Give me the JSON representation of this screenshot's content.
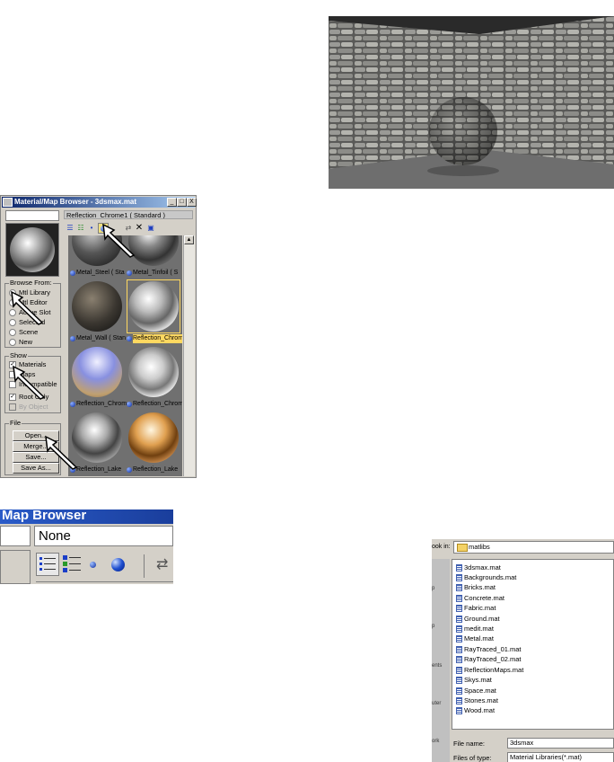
{
  "browser": {
    "title": "Material/Map Browser - 3dsmax.mat",
    "material_name": "Reflection_Chrome1  ( Standard )",
    "win_buttons": [
      "_",
      "□",
      "X"
    ],
    "toolbar_icons": [
      "view-list-icon",
      "view-list-icons-icon",
      "view-small-icon",
      "view-large-icon",
      "update-scene-icon",
      "delete-icon",
      "clear-library-icon"
    ],
    "browse_from": {
      "label": "Browse From:",
      "options": [
        "Mtl Library",
        "Mtl Editor",
        "Active Slot",
        "Selected",
        "Scene",
        "New"
      ],
      "selected": "Mtl Library"
    },
    "show": {
      "label": "Show",
      "options": [
        {
          "label": "Materials",
          "checked": true,
          "enabled": true
        },
        {
          "label": "Maps",
          "checked": false,
          "enabled": true
        },
        {
          "label": "Incompatible",
          "checked": false,
          "enabled": true
        },
        {
          "label": "Root Only",
          "checked": true,
          "enabled": true
        },
        {
          "label": "By Object",
          "checked": false,
          "enabled": false
        }
      ]
    },
    "file": {
      "label": "File",
      "buttons": [
        "Open...",
        "Merge...",
        "Save...",
        "Save As..."
      ]
    },
    "materials": [
      {
        "label": "Metal_Steel  ( Sta",
        "selected": false
      },
      {
        "label": "Metal_Tinfoil  ( S",
        "selected": false
      },
      {
        "label": "Metal_Wall  ( Stan",
        "selected": false
      },
      {
        "label": "Reflection_Chrom",
        "selected": true
      },
      {
        "label": "Reflection_Chrom",
        "selected": false
      },
      {
        "label": "Reflection_Chrom",
        "selected": false
      },
      {
        "label": "Reflection_Lake",
        "selected": false
      },
      {
        "label": "Reflection_Lake",
        "selected": false
      }
    ]
  },
  "zoom": {
    "title": "Map Browser",
    "name_value": "None"
  },
  "dialog": {
    "look_in_label": "ook in:",
    "look_in_value": "matlibs",
    "places": [
      "",
      "p",
      "ents",
      "uter",
      "ork"
    ],
    "files": [
      "3dsmax.mat",
      "Backgrounds.mat",
      "Bricks.mat",
      "Concrete.mat",
      "Fabric.mat",
      "Ground.mat",
      "medit.mat",
      "Metal.mat",
      "RayTraced_01.mat",
      "RayTraced_02.mat",
      "ReflectionMaps.mat",
      "Skys.mat",
      "Space.mat",
      "Stones.mat",
      "Wood.mat"
    ],
    "file_name_label": "File name:",
    "file_name_value": "3dsmax",
    "file_type_label": "Files of type:",
    "file_type_value": "Material Libraries(*.mat)"
  }
}
